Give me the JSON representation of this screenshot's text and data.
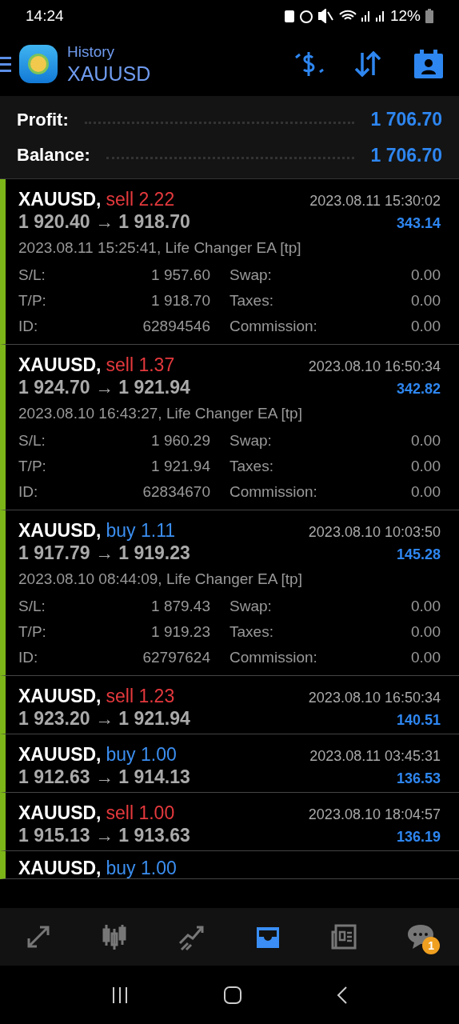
{
  "status_bar": {
    "time": "14:24",
    "battery": "12%"
  },
  "header": {
    "subtitle": "History",
    "title": "XAUUSD"
  },
  "summary": [
    {
      "label": "Profit:",
      "value": "1 706.70"
    },
    {
      "label": "Balance:",
      "value": "1 706.70"
    }
  ],
  "deals": [
    {
      "symbol": "XAUUSD,",
      "side": "sell",
      "volume": "2.22",
      "color": "#e5393d",
      "time": "2023.08.11 15:30:02",
      "prices": "1 920.40 → 1 918.70",
      "profit": "343.14",
      "expanded": true,
      "comment": "2023.08.11 15:25:41, Life Changer EA [tp]",
      "details": [
        [
          "S/L:",
          "1 957.60",
          "Swap:",
          "0.00"
        ],
        [
          "T/P:",
          "1 918.70",
          "Taxes:",
          "0.00"
        ],
        [
          "ID:",
          "62894546",
          "Commission:",
          "0.00"
        ]
      ]
    },
    {
      "symbol": "XAUUSD,",
      "side": "sell",
      "volume": "1.37",
      "color": "#e5393d",
      "time": "2023.08.10 16:50:34",
      "prices": "1 924.70 → 1 921.94",
      "profit": "342.82",
      "expanded": true,
      "comment": "2023.08.10 16:43:27, Life Changer EA [tp]",
      "details": [
        [
          "S/L:",
          "1 960.29",
          "Swap:",
          "0.00"
        ],
        [
          "T/P:",
          "1 921.94",
          "Taxes:",
          "0.00"
        ],
        [
          "ID:",
          "62834670",
          "Commission:",
          "0.00"
        ]
      ]
    },
    {
      "symbol": "XAUUSD,",
      "side": "buy",
      "volume": "1.11",
      "color": "#3b8ef0",
      "time": "2023.08.10 10:03:50",
      "prices": "1 917.79 → 1 919.23",
      "profit": "145.28",
      "expanded": true,
      "comment": "2023.08.10 08:44:09, Life Changer EA [tp]",
      "details": [
        [
          "S/L:",
          "1 879.43",
          "Swap:",
          "0.00"
        ],
        [
          "T/P:",
          "1 919.23",
          "Taxes:",
          "0.00"
        ],
        [
          "ID:",
          "62797624",
          "Commission:",
          "0.00"
        ]
      ]
    },
    {
      "symbol": "XAUUSD,",
      "side": "sell",
      "volume": "1.23",
      "color": "#e5393d",
      "time": "2023.08.10 16:50:34",
      "prices": "1 923.20 → 1 921.94",
      "profit": "140.51",
      "expanded": false
    },
    {
      "symbol": "XAUUSD,",
      "side": "buy",
      "volume": "1.00",
      "color": "#3b8ef0",
      "time": "2023.08.11 03:45:31",
      "prices": "1 912.63 → 1 914.13",
      "profit": "136.53",
      "expanded": false
    },
    {
      "symbol": "XAUUSD,",
      "side": "sell",
      "volume": "1.00",
      "color": "#e5393d",
      "time": "2023.08.10 18:04:57",
      "prices": "1 915.13 → 1 913.63",
      "profit": "136.19",
      "expanded": false
    },
    {
      "symbol": "XAUUSD,",
      "side": "buy",
      "volume": "1.00",
      "color": "#3b8ef0",
      "expanded": false
    }
  ],
  "bottom_nav": [
    {
      "kind": "quotes",
      "selected": false
    },
    {
      "kind": "chart",
      "selected": false
    },
    {
      "kind": "trade",
      "selected": false
    },
    {
      "kind": "history",
      "selected": true
    },
    {
      "kind": "news",
      "selected": false
    },
    {
      "kind": "chat",
      "selected": false,
      "badge": "1"
    }
  ]
}
